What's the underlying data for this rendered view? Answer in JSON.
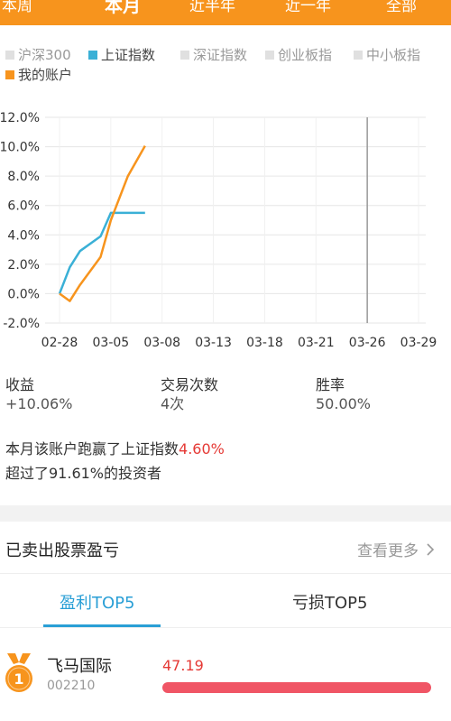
{
  "top_tabs": [
    "本周",
    "本月",
    "近半年",
    "近一年",
    "全部"
  ],
  "top_tabs_active": "本月",
  "legend": [
    {
      "label": "沪深300",
      "color": "#e0e0e0",
      "active": false
    },
    {
      "label": "上证指数",
      "color": "#3ab0d6",
      "active": true
    },
    {
      "label": "深证指数",
      "color": "#e0e0e0",
      "active": false
    },
    {
      "label": "创业板指",
      "color": "#e0e0e0",
      "active": false
    },
    {
      "label": "中小板指",
      "color": "#e0e0e0",
      "active": false
    },
    {
      "label": "我的账户",
      "color": "#f7941d",
      "active": true
    }
  ],
  "chart_data": {
    "type": "line",
    "x_ticks": [
      "02-28",
      "03-05",
      "03-08",
      "03-13",
      "03-18",
      "03-21",
      "03-26",
      "03-29"
    ],
    "y_ticks": [
      "12.0%",
      "10.0%",
      "8.0%",
      "6.0%",
      "4.0%",
      "2.0%",
      "0.0%",
      "-2.0%"
    ],
    "ylim": [
      -2,
      12
    ],
    "series": [
      {
        "name": "上证指数",
        "color": "#3ab0d6",
        "x": [
          "02-28",
          "03-01",
          "03-02",
          "03-04",
          "03-05",
          "03-06",
          "03-07"
        ],
        "values": [
          0.0,
          1.8,
          2.9,
          3.9,
          5.5,
          5.5,
          5.5
        ]
      },
      {
        "name": "我的账户",
        "color": "#f7941d",
        "x": [
          "02-28",
          "03-01",
          "03-02",
          "03-04",
          "03-05",
          "03-06",
          "03-07"
        ],
        "values": [
          0.0,
          -0.5,
          0.6,
          2.5,
          5.0,
          8.0,
          10.06
        ]
      }
    ],
    "marker_date": "03-26"
  },
  "stats": [
    {
      "label": "收益",
      "value": "+10.06%"
    },
    {
      "label": "交易次数",
      "value": "4次"
    },
    {
      "label": "胜率",
      "value": "50.00%"
    }
  ],
  "summary": {
    "line1_prefix": "本月该账户跑赢了上证指数",
    "line1_highlight": "4.60%",
    "line2": "超过了91.61%的投资者"
  },
  "sold_section": {
    "title": "已卖出股票盈亏",
    "more_label": "查看更多"
  },
  "rank_tabs": {
    "profit_label": "盈利TOP5",
    "loss_label": "亏损TOP5"
  },
  "top_list": [
    {
      "rank": "1",
      "name": "飞马国际",
      "code": "002210",
      "value": "47.19",
      "fill": 1.0
    }
  ],
  "colors": {
    "accent": "#f7941d",
    "blue": "#2a9fd6",
    "red": "#e53935"
  }
}
